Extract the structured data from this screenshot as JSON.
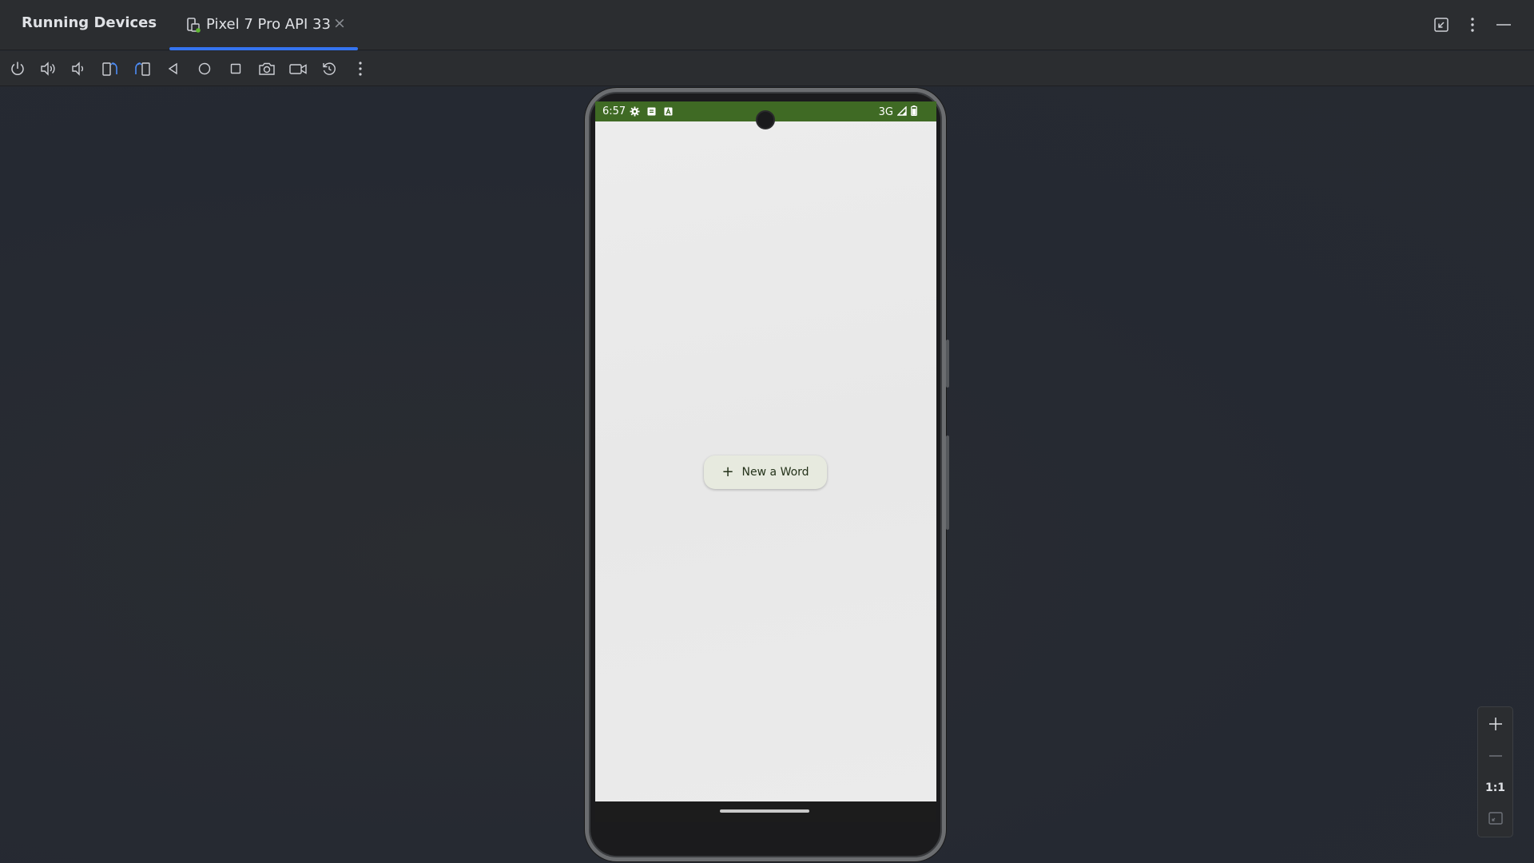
{
  "panel": {
    "title": "Running Devices"
  },
  "tab": {
    "label": "Pixel 7 Pro API 33",
    "close_glyph": "×",
    "icon": "device-mirror-icon"
  },
  "window_actions": [
    {
      "name": "restore-icon"
    },
    {
      "name": "more-options-icon"
    },
    {
      "name": "minimize-icon"
    }
  ],
  "toolbar": [
    {
      "name": "power-icon"
    },
    {
      "name": "volume-up-icon"
    },
    {
      "name": "volume-down-icon"
    },
    {
      "name": "rotate-left-icon"
    },
    {
      "name": "rotate-right-icon"
    },
    {
      "name": "back-icon"
    },
    {
      "name": "home-icon"
    },
    {
      "name": "overview-icon"
    },
    {
      "name": "screenshot-icon"
    },
    {
      "name": "screen-record-icon"
    },
    {
      "name": "reset-icon"
    },
    {
      "name": "more-actions-icon"
    }
  ],
  "device": {
    "status_bar": {
      "time": "6:57",
      "network": "3G",
      "icons": [
        "settings-icon",
        "sim-icon",
        "keyboard-icon"
      ],
      "color": "#3f6a24"
    },
    "fab": {
      "label": "New a Word",
      "icon_glyph": "+"
    }
  },
  "zoom": {
    "zoom_in_glyph": "+",
    "zoom_out_glyph": "—",
    "actual_size": "1:1"
  },
  "colors": {
    "accent": "#3574f0",
    "background": "#262a31",
    "panel": "#2b2d30"
  }
}
